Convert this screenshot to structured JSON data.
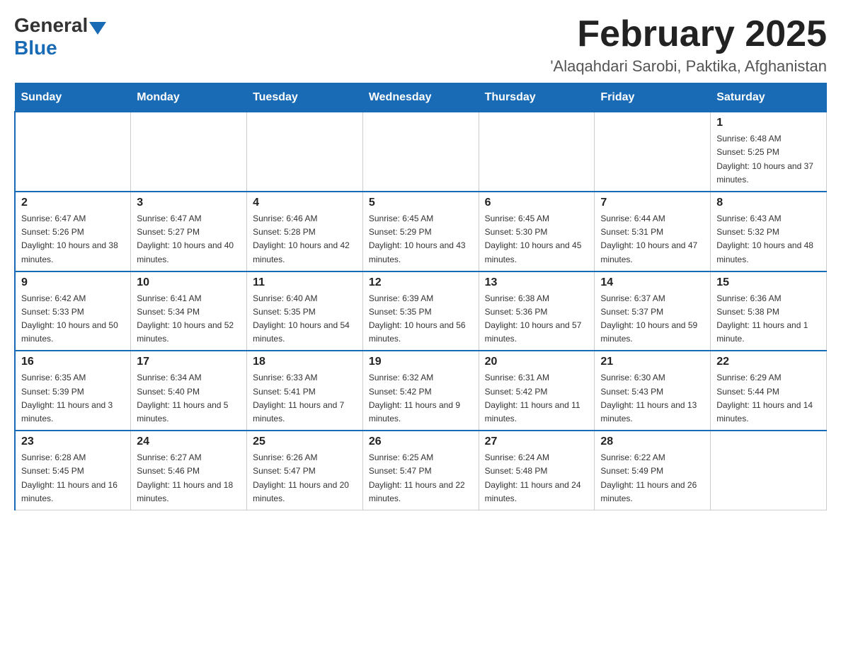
{
  "header": {
    "logo_general": "General",
    "logo_blue": "Blue",
    "month_title": "February 2025",
    "location": "'Alaqahdari Sarobi, Paktika, Afghanistan"
  },
  "weekdays": [
    "Sunday",
    "Monday",
    "Tuesday",
    "Wednesday",
    "Thursday",
    "Friday",
    "Saturday"
  ],
  "weeks": [
    [
      {
        "day": "",
        "info": ""
      },
      {
        "day": "",
        "info": ""
      },
      {
        "day": "",
        "info": ""
      },
      {
        "day": "",
        "info": ""
      },
      {
        "day": "",
        "info": ""
      },
      {
        "day": "",
        "info": ""
      },
      {
        "day": "1",
        "info": "Sunrise: 6:48 AM\nSunset: 5:25 PM\nDaylight: 10 hours and 37 minutes."
      }
    ],
    [
      {
        "day": "2",
        "info": "Sunrise: 6:47 AM\nSunset: 5:26 PM\nDaylight: 10 hours and 38 minutes."
      },
      {
        "day": "3",
        "info": "Sunrise: 6:47 AM\nSunset: 5:27 PM\nDaylight: 10 hours and 40 minutes."
      },
      {
        "day": "4",
        "info": "Sunrise: 6:46 AM\nSunset: 5:28 PM\nDaylight: 10 hours and 42 minutes."
      },
      {
        "day": "5",
        "info": "Sunrise: 6:45 AM\nSunset: 5:29 PM\nDaylight: 10 hours and 43 minutes."
      },
      {
        "day": "6",
        "info": "Sunrise: 6:45 AM\nSunset: 5:30 PM\nDaylight: 10 hours and 45 minutes."
      },
      {
        "day": "7",
        "info": "Sunrise: 6:44 AM\nSunset: 5:31 PM\nDaylight: 10 hours and 47 minutes."
      },
      {
        "day": "8",
        "info": "Sunrise: 6:43 AM\nSunset: 5:32 PM\nDaylight: 10 hours and 48 minutes."
      }
    ],
    [
      {
        "day": "9",
        "info": "Sunrise: 6:42 AM\nSunset: 5:33 PM\nDaylight: 10 hours and 50 minutes."
      },
      {
        "day": "10",
        "info": "Sunrise: 6:41 AM\nSunset: 5:34 PM\nDaylight: 10 hours and 52 minutes."
      },
      {
        "day": "11",
        "info": "Sunrise: 6:40 AM\nSunset: 5:35 PM\nDaylight: 10 hours and 54 minutes."
      },
      {
        "day": "12",
        "info": "Sunrise: 6:39 AM\nSunset: 5:35 PM\nDaylight: 10 hours and 56 minutes."
      },
      {
        "day": "13",
        "info": "Sunrise: 6:38 AM\nSunset: 5:36 PM\nDaylight: 10 hours and 57 minutes."
      },
      {
        "day": "14",
        "info": "Sunrise: 6:37 AM\nSunset: 5:37 PM\nDaylight: 10 hours and 59 minutes."
      },
      {
        "day": "15",
        "info": "Sunrise: 6:36 AM\nSunset: 5:38 PM\nDaylight: 11 hours and 1 minute."
      }
    ],
    [
      {
        "day": "16",
        "info": "Sunrise: 6:35 AM\nSunset: 5:39 PM\nDaylight: 11 hours and 3 minutes."
      },
      {
        "day": "17",
        "info": "Sunrise: 6:34 AM\nSunset: 5:40 PM\nDaylight: 11 hours and 5 minutes."
      },
      {
        "day": "18",
        "info": "Sunrise: 6:33 AM\nSunset: 5:41 PM\nDaylight: 11 hours and 7 minutes."
      },
      {
        "day": "19",
        "info": "Sunrise: 6:32 AM\nSunset: 5:42 PM\nDaylight: 11 hours and 9 minutes."
      },
      {
        "day": "20",
        "info": "Sunrise: 6:31 AM\nSunset: 5:42 PM\nDaylight: 11 hours and 11 minutes."
      },
      {
        "day": "21",
        "info": "Sunrise: 6:30 AM\nSunset: 5:43 PM\nDaylight: 11 hours and 13 minutes."
      },
      {
        "day": "22",
        "info": "Sunrise: 6:29 AM\nSunset: 5:44 PM\nDaylight: 11 hours and 14 minutes."
      }
    ],
    [
      {
        "day": "23",
        "info": "Sunrise: 6:28 AM\nSunset: 5:45 PM\nDaylight: 11 hours and 16 minutes."
      },
      {
        "day": "24",
        "info": "Sunrise: 6:27 AM\nSunset: 5:46 PM\nDaylight: 11 hours and 18 minutes."
      },
      {
        "day": "25",
        "info": "Sunrise: 6:26 AM\nSunset: 5:47 PM\nDaylight: 11 hours and 20 minutes."
      },
      {
        "day": "26",
        "info": "Sunrise: 6:25 AM\nSunset: 5:47 PM\nDaylight: 11 hours and 22 minutes."
      },
      {
        "day": "27",
        "info": "Sunrise: 6:24 AM\nSunset: 5:48 PM\nDaylight: 11 hours and 24 minutes."
      },
      {
        "day": "28",
        "info": "Sunrise: 6:22 AM\nSunset: 5:49 PM\nDaylight: 11 hours and 26 minutes."
      },
      {
        "day": "",
        "info": ""
      }
    ]
  ]
}
